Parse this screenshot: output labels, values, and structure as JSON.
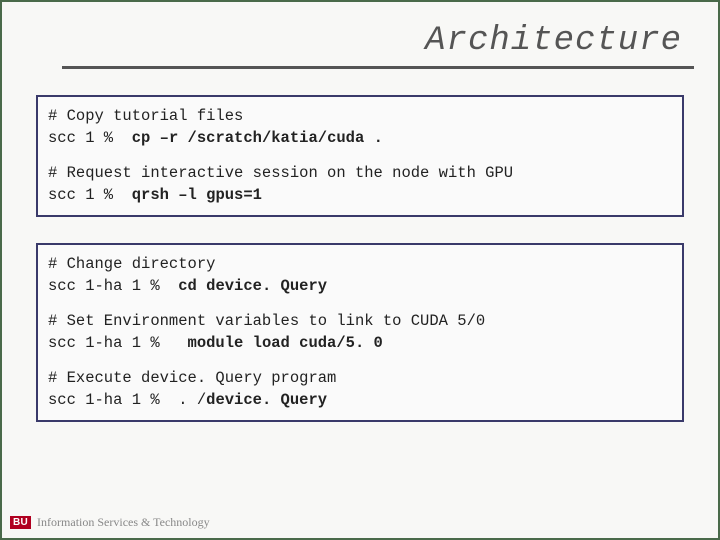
{
  "title": "Architecture",
  "box1": {
    "sections": [
      {
        "comment": "# Copy tutorial files",
        "prompt": "scc 1 % ",
        "cmd_pre": " ",
        "cmd_bold": "cp –r /scratch/katia/cuda .",
        "cmd_post": ""
      },
      {
        "comment": "# Request interactive session on the node with GPU",
        "prompt": "scc 1 % ",
        "cmd_pre": " ",
        "cmd_bold": "qrsh –l gpus=1",
        "cmd_post": ""
      }
    ]
  },
  "box2": {
    "sections": [
      {
        "comment": "# Change directory",
        "prompt": "scc 1-ha 1 % ",
        "cmd_pre": " ",
        "cmd_bold": "cd device. Query",
        "cmd_post": ""
      },
      {
        "comment": "# Set Environment variables to link to CUDA 5/0",
        "prompt": "scc 1-ha 1 % ",
        "cmd_pre": "  ",
        "cmd_bold": "module load cuda/5. 0",
        "cmd_post": ""
      },
      {
        "comment": "# Execute device. Query program",
        "prompt": "scc 1-ha 1 % ",
        "cmd_pre": " . /",
        "cmd_bold": "device. Query",
        "cmd_post": ""
      }
    ]
  },
  "footer": {
    "badge": "BU",
    "text": "Information Services & Technology"
  }
}
